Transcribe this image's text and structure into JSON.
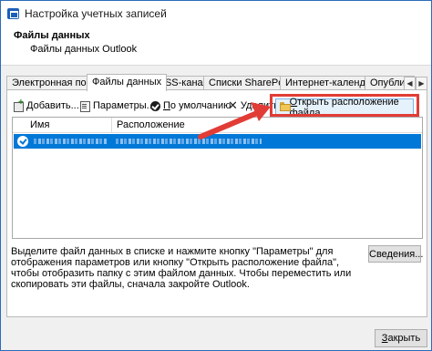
{
  "window": {
    "title": "Настройка учетных записей"
  },
  "header": {
    "title": "Файлы данных",
    "subtitle": "Файлы данных Outlook"
  },
  "tabs": [
    {
      "label": "Электронная почта"
    },
    {
      "label": "Файлы данных",
      "active": true
    },
    {
      "label": "RSS-каналы"
    },
    {
      "label": "Списки SharePoint"
    },
    {
      "label": "Интернет-календари"
    },
    {
      "label": "Опублик"
    }
  ],
  "tab_scroll": {
    "left": "◀",
    "right": "▶"
  },
  "toolbar": {
    "add_key": "Д",
    "add_rest": "обавить...",
    "params_label": "Параметры...",
    "default_key": "П",
    "default_rest": "о умолчанию",
    "delete_label": "Удалить",
    "open_location_key": "О",
    "open_location_rest": "ткрыть расположение файла..."
  },
  "table": {
    "columns": [
      {
        "label": "Имя"
      },
      {
        "label": "Расположение"
      }
    ]
  },
  "description": "Выделите файл данных в списке и нажмите кнопку \"Параметры\" для отображения параметров или кнопку \"Открыть расположение файла\", чтобы отобразить папку с этим файлом данных. Чтобы переместить или скопировать эти файлы, сначала закройте Outlook.",
  "buttons": {
    "details": "Сведения...",
    "close_key": "З",
    "close_rest": "акрыть"
  },
  "colors": {
    "selection": "#0078d7",
    "highlight": "#e23c36",
    "accent": "#2b6cb8"
  },
  "icons": {
    "app": "account-settings-icon",
    "add": "add-icon",
    "params": "settings-icon",
    "default": "check-circle-icon",
    "delete": "delete-x-icon",
    "open": "folder-icon",
    "row": "check-circle-icon"
  }
}
